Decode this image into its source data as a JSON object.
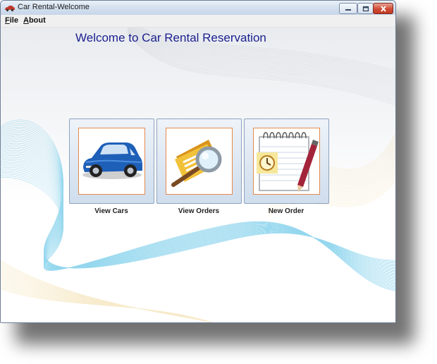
{
  "window": {
    "title": "Car Rental-Welcome"
  },
  "menu": {
    "file": "File",
    "about": "About"
  },
  "main": {
    "heading": "Welcome to Car Rental Reservation",
    "tiles": [
      {
        "label": "View Cars",
        "icon": "car-icon"
      },
      {
        "label": "View Orders",
        "icon": "orders-magnifier-icon"
      },
      {
        "label": "New Order",
        "icon": "notepad-clock-pencil-icon"
      }
    ]
  },
  "colors": {
    "heading": "#1a1f8f",
    "tile_border": "#e58a4a",
    "close_button": "#cf4b35"
  }
}
